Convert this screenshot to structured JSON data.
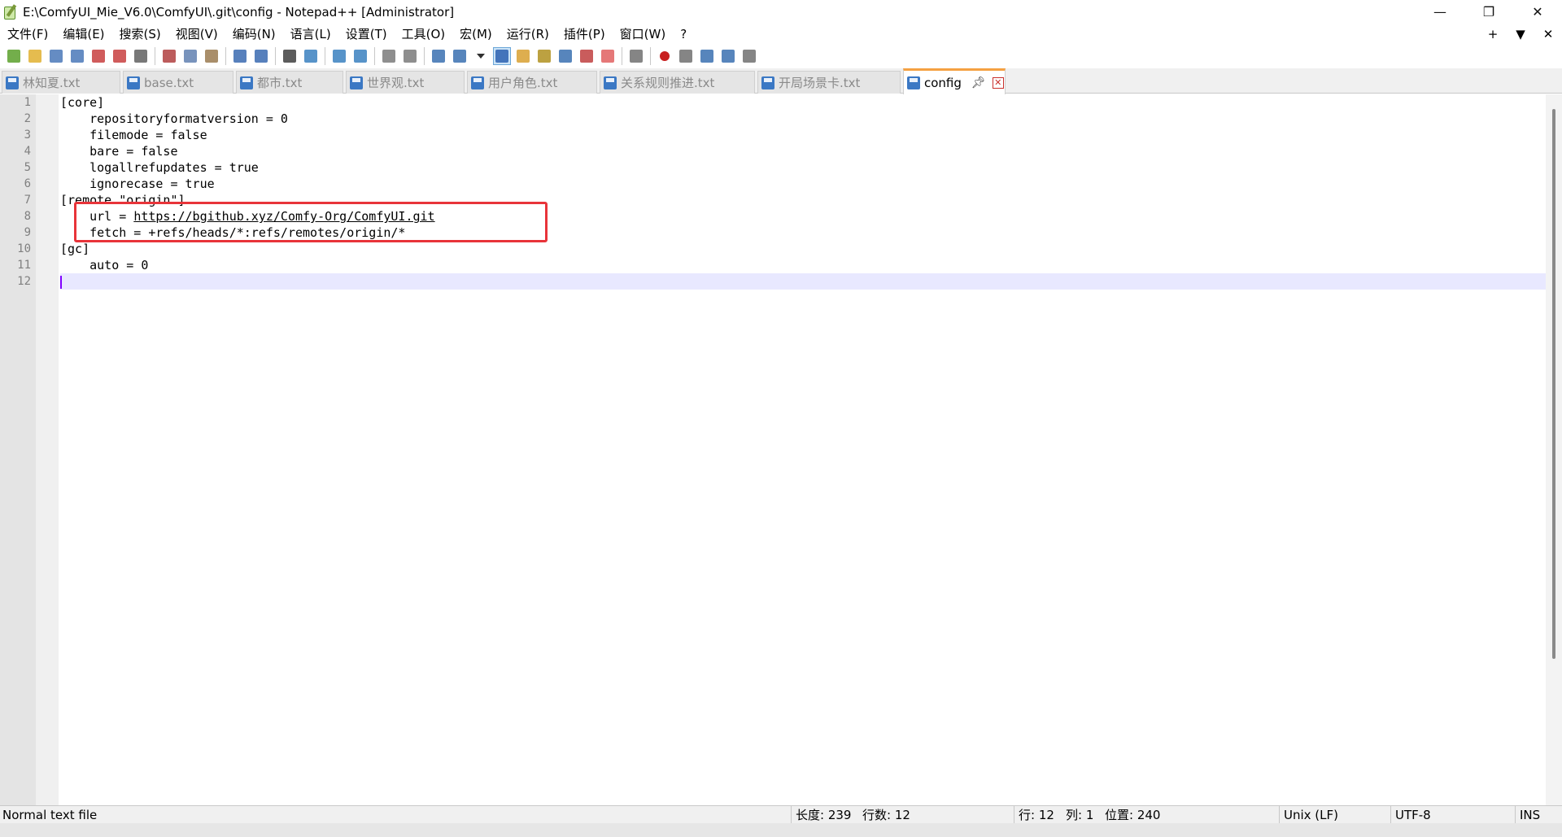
{
  "window": {
    "title": "E:\\ComfyUI_Mie_V6.0\\ComfyUI\\.git\\config - Notepad++ [Administrator]",
    "minimize": "—",
    "maximize": "❐",
    "close": "✕"
  },
  "menu": {
    "items": [
      "文件(F)",
      "编辑(E)",
      "搜索(S)",
      "视图(V)",
      "编码(N)",
      "语言(L)",
      "设置(T)",
      "工具(O)",
      "宏(M)",
      "运行(R)",
      "插件(P)",
      "窗口(W)",
      "?"
    ],
    "right": [
      "+",
      "▼",
      "✕"
    ]
  },
  "toolbar": {
    "icons": [
      "new-file-icon",
      "open-file-icon",
      "save-icon",
      "save-all-icon",
      "close-icon",
      "close-all-icon",
      "print-icon",
      "cut-icon",
      "copy-icon",
      "paste-icon",
      "undo-icon",
      "redo-icon",
      "find-icon",
      "replace-icon",
      "zoom-in-icon",
      "zoom-out-icon",
      "sync-vertical-icon",
      "sync-horizontal-icon",
      "word-wrap-icon",
      "show-all-chars-icon",
      "dropdown-icon",
      "indent-guide-icon",
      "function-list-icon",
      "doc-map-icon",
      "document-list-icon",
      "folder-workspace-icon",
      "monitoring-icon",
      "eye-icon",
      "record-macro-icon",
      "stop-macro-icon",
      "play-macro-icon",
      "run-macro-multiple-icon",
      "save-macro-icon"
    ]
  },
  "tabs": [
    {
      "label": "林知夏.txt",
      "active": false
    },
    {
      "label": "base.txt",
      "active": false
    },
    {
      "label": "都市.txt",
      "active": false
    },
    {
      "label": "世界观.txt",
      "active": false
    },
    {
      "label": "用户角色.txt",
      "active": false
    },
    {
      "label": "关系规则推进.txt",
      "active": false
    },
    {
      "label": "开局场景卡.txt",
      "active": false
    },
    {
      "label": "config",
      "active": true
    }
  ],
  "editor": {
    "line_numbers": [
      "1",
      "2",
      "3",
      "4",
      "5",
      "6",
      "7",
      "8",
      "9",
      "10",
      "11",
      "12"
    ],
    "lines": [
      "[core]",
      "    repositoryformatversion = 0",
      "    filemode = false",
      "    bare = false",
      "    logallrefupdates = true",
      "    ignorecase = true",
      "[remote \"origin\"]",
      "    url = ",
      "    fetch = +refs/heads/*:refs/remotes/origin/*",
      "[gc]",
      "    auto = 0",
      ""
    ],
    "url_link": "https://bgithub.xyz/Comfy-Org/ComfyUI.git",
    "current_line": 12
  },
  "status": {
    "file_type": "Normal text file",
    "length": "长度: 239",
    "lines": "行数: 12",
    "row": "行: 12",
    "col": "列: 1",
    "pos": "位置: 240",
    "eol": "Unix (LF)",
    "encoding": "UTF-8",
    "mode": "INS"
  },
  "colors": {
    "highlight_box": "#e8343a",
    "active_tab_accent": "#f5a142",
    "current_line_bg": "#e8e8ff",
    "caret": "#8000ff"
  }
}
